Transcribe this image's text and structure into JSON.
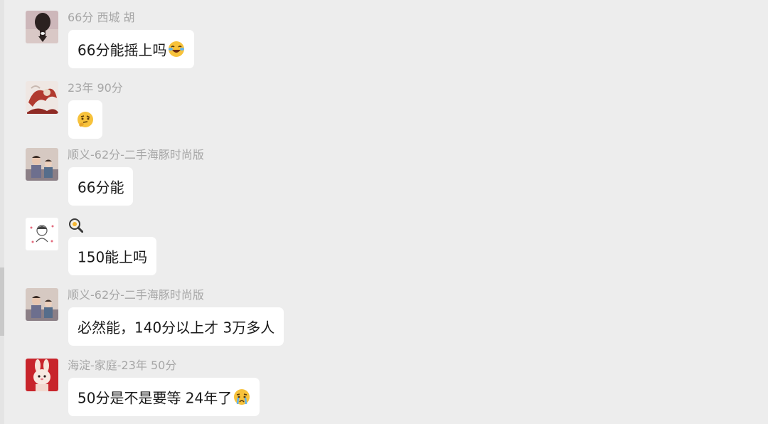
{
  "scrollbar": {
    "label": "chat-scrollbar"
  },
  "messages": [
    {
      "sender": "66分 西城 胡",
      "text": "66分能摇上吗",
      "emoji": "laughing-crying-emoji",
      "avatar": "portrait-avatar"
    },
    {
      "sender": "23年 90分",
      "text": "",
      "emoji": "thinking-face-emoji",
      "avatar": "illustrated-dragon-avatar"
    },
    {
      "sender": "顺义-62分-二手海豚时尚版",
      "text": "66分能",
      "emoji": "",
      "avatar": "family-photo-avatar"
    },
    {
      "sender": "",
      "sender_emoji": "frying-pan-egg-emoji",
      "text": "150能上吗",
      "emoji": "",
      "avatar": "cartoon-figure-avatar"
    },
    {
      "sender": "顺义-62分-二手海豚时尚版",
      "text": "必然能，140分以上才 3万多人",
      "emoji": "",
      "avatar": "family-photo-avatar"
    },
    {
      "sender": "海淀-家庭-23年 50分",
      "text": "50分是不是要等 24年了",
      "emoji": "crying-face-emoji",
      "avatar": "rabbit-avatar"
    }
  ],
  "colors": {
    "background": "#ededed",
    "bubble": "#ffffff",
    "sender": "#a6a6a6",
    "text": "#1a1a1a"
  }
}
